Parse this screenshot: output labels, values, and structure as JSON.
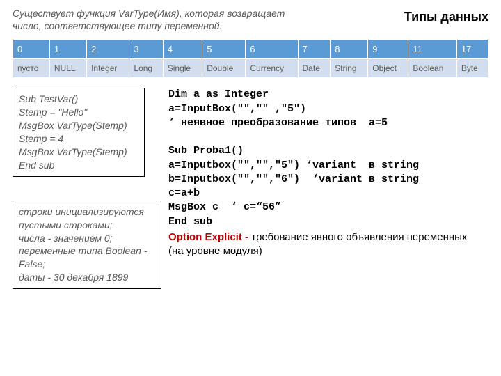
{
  "header": {
    "intro_prefix": "Существует функция ",
    "intro_fn": "VarType(Имя)",
    "intro_suffix": ", которая возвращает число, соответствующее типу переменной.",
    "title": "Типы данных"
  },
  "table": {
    "headers": [
      "0",
      "1",
      "2",
      "3",
      "4",
      "5",
      "6",
      "7",
      "8",
      "9",
      "11",
      "17"
    ],
    "cells": [
      "пусто",
      "NULL",
      "Integer",
      "Long",
      "Single",
      "Double",
      "Currency",
      "Date",
      "String",
      "Object",
      "Boolean",
      "Byte"
    ]
  },
  "left": {
    "box1_lines": [
      "Sub TestVar()",
      "Stemp = \"Hello\"",
      "MsgBox VarType(Stemp)",
      "Stemp = 4",
      "MsgBox VarType(Stemp)",
      "End sub"
    ],
    "box2_lines": [
      "строки инициализируются пустыми строками;",
      "числа - значением 0;",
      "переменные типа Boolean - False;",
      "даты - 30 декабря 1899"
    ]
  },
  "right": {
    "code_lines": [
      "Dim a as Integer",
      "a=InputBox(\"\",\"\" ,\"5\")",
      "‘ неявное преобразование типов  a=5",
      "",
      "Sub Proba1()",
      "a=Inputbox(\"\",\"\",\"5\") ‘variant  в string",
      "b=Inputbox(\"\",\"\",\"6\")  ‘variant в string",
      "c=a+b",
      "MsgBox c  ‘ c=“56”",
      "End sub"
    ],
    "option_label": "Option Explicit  -  ",
    "option_text1": "требование явного объявления переменных",
    "option_text2": "(на уровне модуля)"
  }
}
